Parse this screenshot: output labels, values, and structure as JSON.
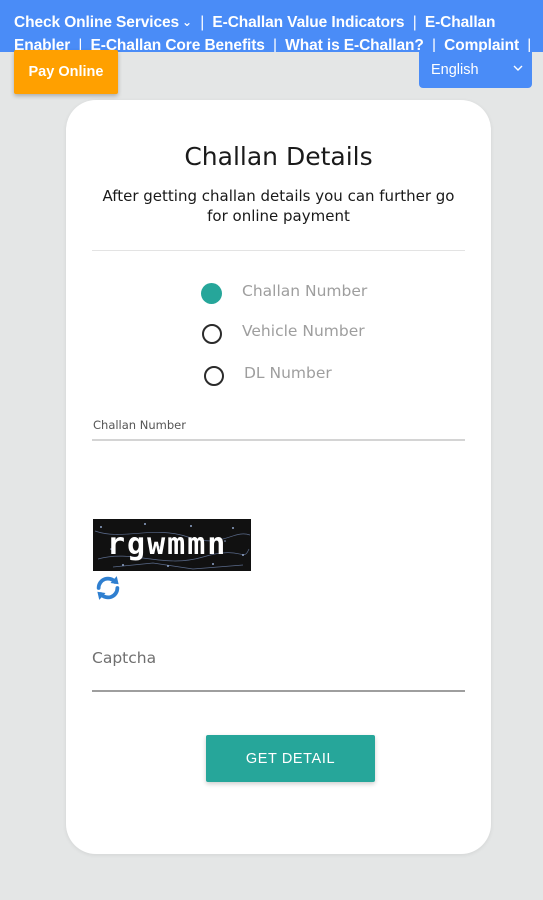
{
  "nav": {
    "check_online_services": "Check Online Services",
    "links_line1": [
      "E-Challan Value Indicators",
      "E-Challan"
    ],
    "links_line2": [
      "Enabler",
      "E-Challan Core Benefits",
      "What is E-Challan?",
      "Complaint"
    ],
    "separator": "|"
  },
  "pay_online": "Pay Online",
  "language": {
    "selected": "English"
  },
  "card": {
    "title": "Challan Details",
    "subtitle": "After getting challan details you can further go for online payment",
    "radio_options": [
      {
        "label": "Challan Number",
        "checked": true
      },
      {
        "label": "Vehicle Number",
        "checked": false
      },
      {
        "label": "DL Number",
        "checked": false
      }
    ],
    "challan_field_label": "Challan Number",
    "challan_field_value": "",
    "captcha_code": "rgwmmn",
    "captcha_placeholder": "Captcha",
    "submit_label": "GET DETAIL"
  },
  "colors": {
    "nav_blue": "#4a8cf7",
    "pay_orange": "#ffa000",
    "teal": "#26a69a",
    "refresh_blue": "#2f7fd0"
  },
  "icons": {
    "nav_dropdown": "chevron-down-icon",
    "language_dropdown": "chevron-down-icon",
    "captcha_refresh": "refresh-icon"
  }
}
